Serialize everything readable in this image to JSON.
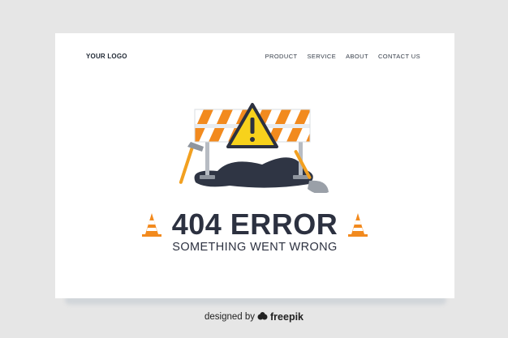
{
  "header": {
    "logo": "YOUR LOGO",
    "nav": [
      {
        "label": "PRODUCT"
      },
      {
        "label": "SERVICE"
      },
      {
        "label": "ABOUT"
      },
      {
        "label": "CONTACT US"
      }
    ]
  },
  "main": {
    "error_title": "404 ERROR",
    "error_subtitle": "SOMETHING WENT WRONG"
  },
  "footer": {
    "credit_prefix": "designed by",
    "credit_brand": "freepik"
  },
  "colors": {
    "background": "#e6e6e6",
    "card": "#ffffff",
    "text_dark": "#2c3140",
    "orange": "#f28a1e",
    "warning_yellow": "#f7d21c"
  },
  "icons": [
    "warning-icon",
    "traffic-cone-icon",
    "freepik-logo-icon"
  ]
}
